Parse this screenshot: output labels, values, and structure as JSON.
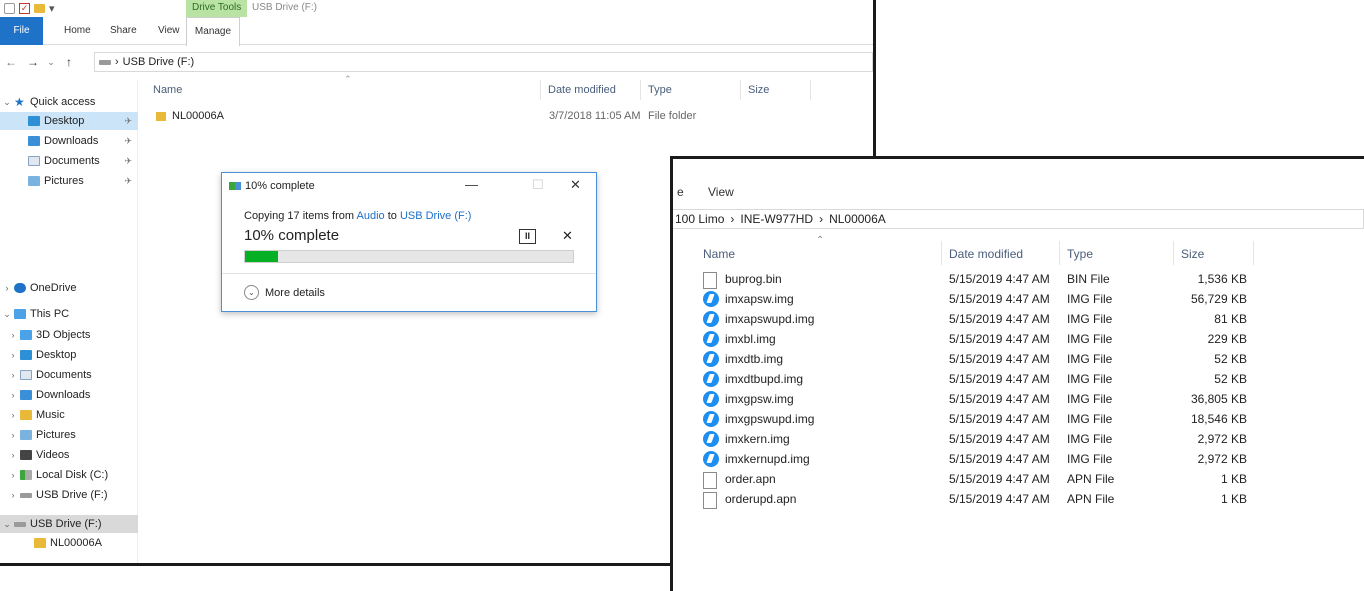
{
  "win1": {
    "drive_tools": "Drive Tools",
    "title": "USB Drive (F:)",
    "ribbon": {
      "file": "File",
      "home": "Home",
      "share": "Share",
      "view": "View",
      "manage": "Manage"
    },
    "address": {
      "crumb": "USB Drive (F:)"
    },
    "nav": {
      "quick_access": "Quick access",
      "desktop": "Desktop",
      "downloads": "Downloads",
      "documents": "Documents",
      "pictures": "Pictures",
      "onedrive": "OneDrive",
      "this_pc": "This PC",
      "objects3d": "3D Objects",
      "pc_desktop": "Desktop",
      "pc_documents": "Documents",
      "pc_downloads": "Downloads",
      "music": "Music",
      "pc_pictures": "Pictures",
      "videos": "Videos",
      "local_disk": "Local Disk (C:)",
      "usb_drive": "USB Drive (F:)",
      "usb_drive_expanded": "USB Drive (F:)",
      "nl_folder": "NL00006A"
    },
    "columns": {
      "name": "Name",
      "date": "Date modified",
      "type": "Type",
      "size": "Size"
    },
    "rows": [
      {
        "name": "NL00006A",
        "date": "3/7/2018 11:05 AM",
        "type": "File folder",
        "size": ""
      }
    ]
  },
  "dialog": {
    "title": "10% complete",
    "copy_prefix": "Copying 17 items from ",
    "source": "Audio",
    "to": " to ",
    "dest": "USB Drive (F:)",
    "percent_label": "10% complete",
    "progress": 0.1,
    "more_details": "More details",
    "pause_glyph": "II",
    "cancel_glyph": "✕",
    "min_glyph": "—",
    "max_glyph": "☐",
    "close_glyph": "✕"
  },
  "win2": {
    "ribbon_e": "e",
    "view": "View",
    "breadcrumb": [
      "100 Limo",
      "INE-W977HD",
      "NL00006A"
    ],
    "columns": {
      "name": "Name",
      "date": "Date modified",
      "type": "Type",
      "size": "Size"
    },
    "rows": [
      {
        "name": "buprog.bin",
        "date": "5/15/2019 4:47 AM",
        "type": "BIN File",
        "size": "1,536 KB",
        "icon": "file-icon"
      },
      {
        "name": "imxapsw.img",
        "date": "5/15/2019 4:47 AM",
        "type": "IMG File",
        "size": "56,729 KB",
        "icon": "img-icon"
      },
      {
        "name": "imxapswupd.img",
        "date": "5/15/2019 4:47 AM",
        "type": "IMG File",
        "size": "81 KB",
        "icon": "img-icon"
      },
      {
        "name": "imxbl.img",
        "date": "5/15/2019 4:47 AM",
        "type": "IMG File",
        "size": "229 KB",
        "icon": "img-icon"
      },
      {
        "name": "imxdtb.img",
        "date": "5/15/2019 4:47 AM",
        "type": "IMG File",
        "size": "52 KB",
        "icon": "img-icon"
      },
      {
        "name": "imxdtbupd.img",
        "date": "5/15/2019 4:47 AM",
        "type": "IMG File",
        "size": "52 KB",
        "icon": "img-icon"
      },
      {
        "name": "imxgpsw.img",
        "date": "5/15/2019 4:47 AM",
        "type": "IMG File",
        "size": "36,805 KB",
        "icon": "img-icon"
      },
      {
        "name": "imxgpswupd.img",
        "date": "5/15/2019 4:47 AM",
        "type": "IMG File",
        "size": "18,546 KB",
        "icon": "img-icon"
      },
      {
        "name": "imxkern.img",
        "date": "5/15/2019 4:47 AM",
        "type": "IMG File",
        "size": "2,972 KB",
        "icon": "img-icon"
      },
      {
        "name": "imxkernupd.img",
        "date": "5/15/2019 4:47 AM",
        "type": "IMG File",
        "size": "2,972 KB",
        "icon": "img-icon"
      },
      {
        "name": "order.apn",
        "date": "5/15/2019 4:47 AM",
        "type": "APN File",
        "size": "1 KB",
        "icon": "file-icon"
      },
      {
        "name": "orderupd.apn",
        "date": "5/15/2019 4:47 AM",
        "type": "APN File",
        "size": "1 KB",
        "icon": "file-icon"
      }
    ]
  },
  "colors": {
    "accent": "#1e73c8",
    "progress": "#06b025",
    "context_tab": "#b9e3a3",
    "link": "#1e6fc9"
  }
}
